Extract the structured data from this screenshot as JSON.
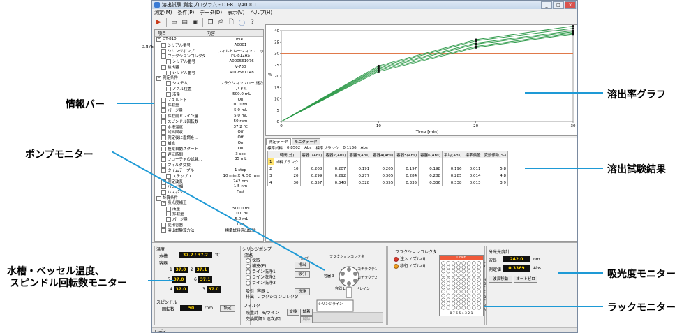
{
  "window": {
    "title": "溶出試験 測定プログラム - DT-810/A0001",
    "menu": [
      "測定(M)",
      "条件(P)",
      "データ(D)",
      "表示(V)",
      "ヘルプ(H)"
    ],
    "status": "レディ"
  },
  "toolbar_icons": [
    "play-icon",
    "new-file-icon",
    "open-file-icon",
    "save-icon",
    "copy-icon",
    "print-icon",
    "print-preview-icon",
    "info-icon",
    "help-icon"
  ],
  "info_bar": {
    "header": [
      "項目",
      "内容"
    ],
    "side_value": "0.875",
    "rows": [
      {
        "k": "DT-810",
        "v": "idle",
        "lvl": 0,
        "grp": true
      },
      {
        "k": "シリアル番号",
        "v": "A0001",
        "lvl": 1
      },
      {
        "k": "シリンジポンプ",
        "v": "フィルトレーションユニット 有",
        "lvl": 1
      },
      {
        "k": "フラクションコレクタ",
        "v": "FC-812AS",
        "lvl": 1
      },
      {
        "k": "シリアル番号",
        "v": "A000561076",
        "lvl": 2
      },
      {
        "k": "検出器",
        "v": "V-730",
        "lvl": 1
      },
      {
        "k": "シリアル番号",
        "v": "A017561148",
        "lvl": 2
      },
      {
        "k": "測定条件",
        "v": "",
        "lvl": 0,
        "grp": true
      },
      {
        "k": "システム",
        "v": "フラクションフロー(逐次測定)",
        "lvl": 2
      },
      {
        "k": "ノズル位置",
        "v": "パドル",
        "lvl": 2
      },
      {
        "k": "液量",
        "v": "500.0 mL",
        "lvl": 2
      },
      {
        "k": "ノズル上下",
        "v": "On",
        "lvl": 1
      },
      {
        "k": "採取量",
        "v": "10.0 mL",
        "lvl": 1
      },
      {
        "k": "パージ量",
        "v": "5.0 mL",
        "lvl": 1
      },
      {
        "k": "採取前ドレイン量",
        "v": "5.0 mL",
        "lvl": 1
      },
      {
        "k": "スピンドル回転数",
        "v": "50 rpm",
        "lvl": 1
      },
      {
        "k": "水槽温度",
        "v": "37.2 ℃",
        "lvl": 1
      },
      {
        "k": "試料回収",
        "v": "Off",
        "lvl": 1
      },
      {
        "k": "測定後に温調を...",
        "v": "Off",
        "lvl": 1
      },
      {
        "k": "補充",
        "v": "On",
        "lvl": 1
      },
      {
        "k": "投薬自動スタート",
        "v": "On",
        "lvl": 1
      },
      {
        "k": "遅延時間",
        "v": "3 sec",
        "lvl": 1
      },
      {
        "k": "フローチャの試験...",
        "v": "35 mL",
        "lvl": 1
      },
      {
        "k": "フィルタ交換",
        "v": "",
        "lvl": 1
      },
      {
        "k": "タイムテーブル",
        "v": "1 step",
        "lvl": 1
      },
      {
        "k": "ステップ 1",
        "v": "10 min X 4, 50 rpm",
        "lvl": 2
      },
      {
        "k": "測定波長",
        "v": "242 nm",
        "lvl": 1
      },
      {
        "k": "バンド幅",
        "v": "1.5 nm",
        "lvl": 1
      },
      {
        "k": "レスポンス",
        "v": "Fast",
        "lvl": 1
      },
      {
        "k": "計算条件",
        "v": "",
        "lvl": 0,
        "grp": true
      },
      {
        "k": "吸光度補正",
        "v": "",
        "lvl": 1,
        "grp": true
      },
      {
        "k": "液量",
        "v": "500.0 mL",
        "lvl": 2
      },
      {
        "k": "採取量",
        "v": "10.0 mL",
        "lvl": 2
      },
      {
        "k": "パージ量",
        "v": "5.0 mL",
        "lvl": 2
      },
      {
        "k": "使用容器",
        "v": "1 - 6",
        "lvl": 1
      },
      {
        "k": "溶出試験算方法",
        "v": "標準試料溶出試験",
        "lvl": 1
      }
    ]
  },
  "graph": {
    "y_label": "%",
    "x_label": "Time [min]",
    "orange_line_color": "#e0794a",
    "green_color": "#2e9a4a"
  },
  "chart_data": {
    "type": "line",
    "title": "",
    "xlabel": "Time [min]",
    "ylabel": "%",
    "xlim": [
      0,
      30
    ],
    "ylim": [
      0,
      40
    ],
    "x_ticks": [
      0,
      10,
      20,
      30
    ],
    "y_ticks": [
      0,
      5,
      10,
      15,
      20,
      25,
      30,
      35,
      40
    ],
    "reference_line_y": 30,
    "x": [
      0,
      10,
      20,
      30
    ],
    "series": [
      {
        "values": [
          0,
          24.5,
          36.0,
          42.0
        ]
      },
      {
        "values": [
          0,
          24.0,
          35.5,
          41.0
        ]
      },
      {
        "values": [
          0,
          23.5,
          34.5,
          40.0
        ]
      },
      {
        "values": [
          0,
          23.0,
          34.0,
          39.5
        ]
      },
      {
        "values": [
          0,
          22.5,
          33.0,
          39.0
        ]
      },
      {
        "values": [
          0,
          22.0,
          32.5,
          38.5
        ]
      }
    ]
  },
  "results": {
    "tabs": [
      "測定データ",
      "モニタデータ"
    ],
    "blank_label": "標準試料",
    "blank_value": "0.8502",
    "blank_unit": "Abs",
    "blank2_label": "標準ブランク",
    "blank2_value": "0.1136",
    "blank2_unit": "Abs",
    "headers": [
      "",
      "時間(分)",
      "容器1(Abs)",
      "容器2(Abs)",
      "容器3(Abs)",
      "容器4(Abs)",
      "容器5(Abs)",
      "容器6(Abs)",
      "平均(Abs)",
      "標準偏差",
      "変動係数(%)"
    ],
    "rows": [
      [
        "1",
        "試料ブランク",
        "",
        "",
        "",
        "",
        "",
        "",
        "",
        "",
        ""
      ],
      [
        "2",
        "10",
        "0.208",
        "0.207",
        "0.191",
        "0.205",
        "0.197",
        "0.198",
        "0.196",
        "0.011",
        "5.8"
      ],
      [
        "3",
        "20",
        "0.299",
        "0.292",
        "0.277",
        "0.305",
        "0.284",
        "0.288",
        "0.285",
        "0.014",
        "4.8"
      ],
      [
        "4",
        "30",
        "0.357",
        "0.340",
        "0.328",
        "0.355",
        "0.335",
        "0.336",
        "0.338",
        "0.013",
        "3.9"
      ]
    ]
  },
  "temperature": {
    "title": "温度",
    "bath_label": "水槽",
    "bath_value": "37.2 / 37.2",
    "bath_unit": "℃",
    "vessel_label": "容器",
    "vessels": [
      {
        "n": "1",
        "v": "37.0"
      },
      {
        "n": "2",
        "v": "37.1"
      },
      {
        "n": "5",
        "v": "37.0"
      },
      {
        "n": "6",
        "v": "37.1"
      },
      {
        "n": "4",
        "v": "37.0"
      },
      {
        "n": "3",
        "v": "37.0"
      }
    ],
    "spindle_title": "スピンドル",
    "spindle_label": "回転数",
    "spindle_value": "50",
    "spindle_unit": "rpm",
    "set_button": "設定"
  },
  "pump": {
    "title": "シリンジポンプ",
    "flow_label": "流路",
    "options": [
      "採取",
      "補充(E)",
      "ライン洗浄1",
      "ライン洗浄2",
      "ライン洗浄3"
    ],
    "suction_label": "吸引",
    "suction_value": "容器 L",
    "discharge_label": "排出",
    "discharge_value": "フラクションコレクタ",
    "valve_title": "バルブ",
    "btn_discharge": "排出",
    "btn_suction": "吸引",
    "btn_wash": "洗浄",
    "filter_title": "フィルタ",
    "filter_remaining_label": "残量計",
    "filter_remaining_value": "6/ライン",
    "filter_interval_label": "交換間隔",
    "filter_interval_value": "1 逐次/回",
    "btn_replace": "交換",
    "btn_test": "試着",
    "btn_clear": "解除"
  },
  "valve_diagram": {
    "top": "フラクションコレクタ",
    "right1": "コチラクチ1",
    "right2": "コチラクチ2",
    "left": "容器 3",
    "bottom_left": "容器 L",
    "drain": "ドレイン",
    "line_label": "シリンジライン"
  },
  "fraction_collector": {
    "title": "フラクションコレクタ",
    "opt1": "注入ノズル(I)",
    "opt2": "移行ノズル(I)"
  },
  "rack": {
    "header": "Drain",
    "cols": "8 7 6 5 4 3 2 1",
    "rows": [
      "L",
      "K",
      "J",
      "I",
      "H",
      "G",
      "F",
      "E",
      "D",
      "C",
      "B",
      "A"
    ]
  },
  "spectro": {
    "title": "分光光度計",
    "wl_label": "波長",
    "wl_value": "242.0",
    "wl_unit": "nm",
    "meas_label": "測定値",
    "meas_value": "0.3369",
    "meas_unit": "Abs",
    "btn_wl": "波長移動",
    "btn_zero": "オートゼロ"
  },
  "annotations": {
    "info_bar": "情報バー",
    "pump_monitor": "ポンプモニター",
    "temp_line1": "水槽・ベッセル温度、",
    "temp_line2": "スピンドル回転数モニター",
    "graph": "溶出率グラフ",
    "results": "溶出試験結果",
    "absorbance": "吸光度モニター",
    "rack": "ラックモニター",
    "line_color": "#1e9ad6"
  }
}
